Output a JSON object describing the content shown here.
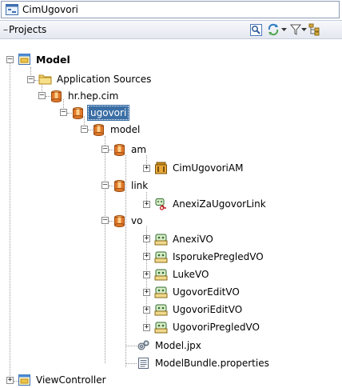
{
  "project_selector": {
    "value": "CimUgovori",
    "icon": "project-window-icon"
  },
  "panel": {
    "title": "Projects",
    "collapse_symbol": "–"
  },
  "toolbar": {
    "items": [
      "search-filter-icon",
      "sync-icon",
      "filter-icon",
      "tree-layout-icon"
    ]
  },
  "tree": {
    "model": "Model",
    "application_sources": "Application Sources",
    "pkg_hr_hep_cim": "hr.hep.cim",
    "pkg_ugovori": "ugovori",
    "pkg_model": "model",
    "pkg_am": "am",
    "cim_ugovori_am": "CimUgovoriAM",
    "pkg_link": "link",
    "anexi_za_ugovor_link": "AnexiZaUgovorLink",
    "pkg_vo": "vo",
    "vo_items": [
      "AnexiVO",
      "IsporukePregledVO",
      "LukeVO",
      "UgovorEditVO",
      "UgovoriEditVO",
      "UgovoriPregledVO"
    ],
    "model_jpx": "Model.jpx",
    "model_bundle": "ModelBundle.properties",
    "view_controller": "ViewController"
  },
  "colors": {
    "selection": "#3a6ea5",
    "package": "#e0782a",
    "folder": "#f3d36b",
    "project": "#4a8bd6"
  }
}
